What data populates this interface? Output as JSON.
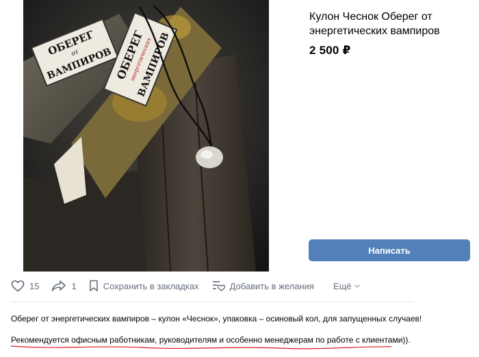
{
  "product": {
    "title": "Кулон Чеснок Оберег от энергетических вампиров",
    "price": "2 500 ₽",
    "write_button": "Написать"
  },
  "photo": {
    "label_top": "ОБЕРЕГ",
    "label_from": "от",
    "label_sub": "энергетических",
    "label_bottom": "ВАМПИРОВ"
  },
  "actions": {
    "likes_count": "15",
    "shares_count": "1",
    "save_label": "Сохранить в закладках",
    "wishlist_label": "Добавить в желания",
    "more_label": "Ещё"
  },
  "description": {
    "line1": "Оберег от энергетических вампиров – кулон «Чеснок», упаковка – осиновый кол, для запущенных случаев!",
    "line2": "Рекомендуется офисным работникам, руководителям и особенно менеджерам по работе с клиентами))."
  },
  "colors": {
    "accent": "#5181b8",
    "icon_gray": "#626d7a",
    "underline_red": "#e0161d"
  }
}
